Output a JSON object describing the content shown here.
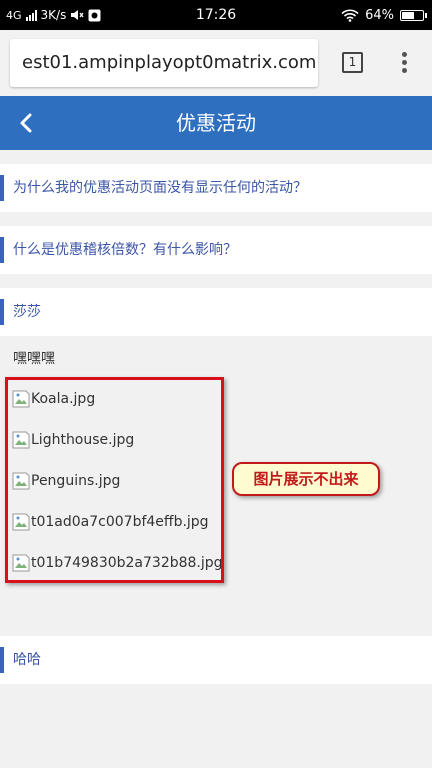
{
  "status_bar": {
    "network": "4G",
    "speed": "3K/s",
    "time": "17:26",
    "battery_text": "64%",
    "battery_level": 0.64
  },
  "browser": {
    "url": "est01.ampinplayopt0matrix.com",
    "tab_count": "1"
  },
  "header": {
    "title": "优惠活动"
  },
  "faq": [
    {
      "question": "为什么我的优惠活动页面没有显示任何的活动？"
    },
    {
      "question": "什么是优惠稽核倍数？有什么影响？"
    }
  ],
  "sections": [
    {
      "label": "莎莎"
    },
    {
      "label": "哈哈"
    }
  ],
  "content": {
    "heading": "嘿嘿嘿",
    "images": [
      "Koala.jpg",
      "Lighthouse.jpg",
      "Penguins.jpg",
      "t01ad0a7c007bf4effb.jpg",
      "t01b749830b2a732b88.jpg"
    ]
  },
  "annotation": {
    "text": "图片展示不出来"
  },
  "colors": {
    "header_bg": "#2f6fc0",
    "link_text": "#3b55a8",
    "annotation_red": "#d6101c"
  }
}
